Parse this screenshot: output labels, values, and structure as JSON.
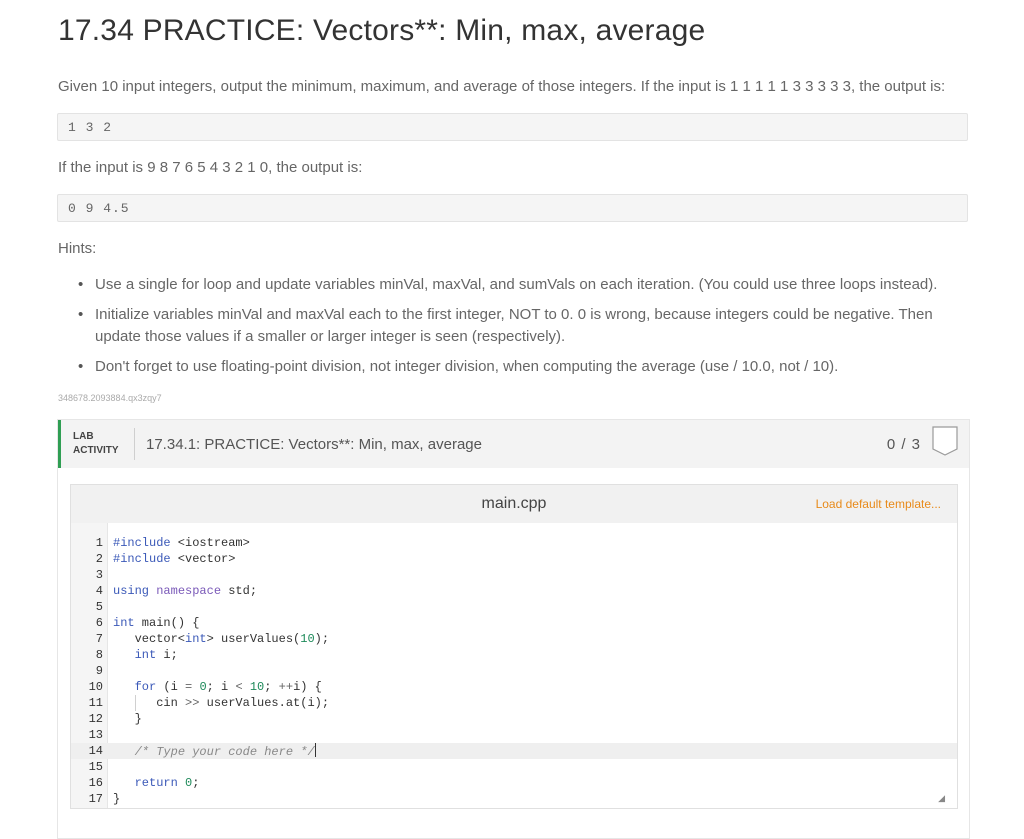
{
  "page": {
    "title": "17.34 PRACTICE: Vectors**: Min, max, average",
    "intro": "Given 10 input integers, output the minimum, maximum, and average of those integers. If the input is 1 1 1 1 1 3 3 3 3 3, the output is:",
    "output1": "1 3 2",
    "second": "If the input is 9 8 7 6 5 4 3 2 1 0, the output is:",
    "output2": "0 9 4.5",
    "hints_label": "Hints:",
    "hints": [
      "Use a single for loop and update variables minVal, maxVal, and sumVals on each iteration. (You could use three loops instead).",
      "Initialize variables minVal and maxVal each to the first integer, NOT to 0. 0 is wrong, because integers could be negative. Then update those values if a smaller or larger integer is seen (respectively).",
      "Don't forget to use floating-point division, not integer division, when computing the average (use / 10.0, not / 10)."
    ],
    "tracking_id": "348678.2093884.qx3zqy7"
  },
  "lab": {
    "badge_line1": "LAB",
    "badge_line2": "ACTIVITY",
    "title": "17.34.1: PRACTICE: Vectors**: Min, max, average",
    "score": "0 / 3",
    "accent": "#2f9e53"
  },
  "editor": {
    "file_name": "main.cpp",
    "load_template": "Load default template...",
    "load_color": "#e88a1a",
    "line_numbers": [
      "1",
      "2",
      "3",
      "4",
      "5",
      "6",
      "7",
      "8",
      "9",
      "10",
      "11",
      "12",
      "13",
      "14",
      "15",
      "16",
      "17"
    ],
    "active_line": "14"
  }
}
